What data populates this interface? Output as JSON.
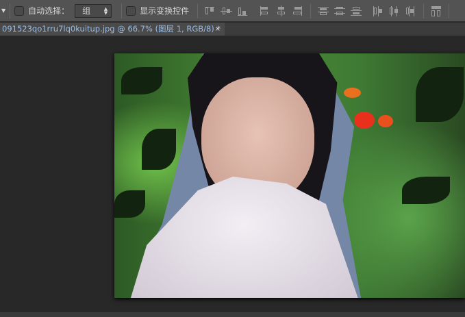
{
  "toolbar": {
    "auto_select_label": "自动选择：",
    "auto_select_value": "组",
    "show_transform_label": "显示变换控件",
    "auto_select_checked": false,
    "show_transform_checked": false
  },
  "document_tab": {
    "title": "091523qo1rru7lq0kuitup.jpg @ 66.7% (图层 1, RGB/8) *",
    "close": "×"
  },
  "icons": [
    "align-top-edges-icon",
    "align-vertical-centers-icon",
    "align-bottom-edges-icon",
    "align-left-edges-icon",
    "align-horizontal-centers-icon",
    "align-right-edges-icon",
    "distribute-top-icon",
    "distribute-vcenter-icon",
    "distribute-bottom-icon",
    "distribute-left-icon",
    "distribute-hcenter-icon",
    "distribute-right-icon",
    "auto-align-layers-icon"
  ]
}
